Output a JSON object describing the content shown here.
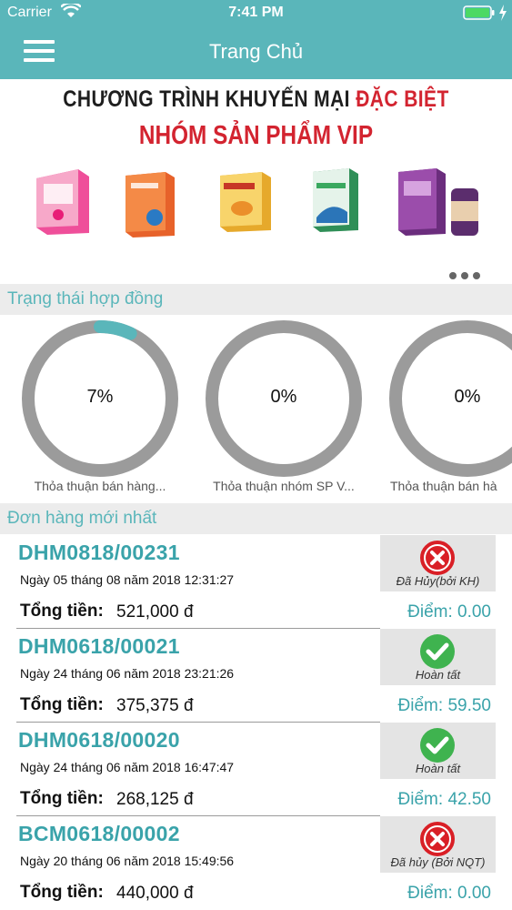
{
  "status_bar": {
    "carrier": "Carrier",
    "time": "7:41 PM"
  },
  "nav": {
    "title": "Trang Chủ"
  },
  "banner": {
    "line1_part1": "CHƯƠNG TRÌNH KHUYẾN MẠI",
    "line1_part2": "ĐẶC BIỆT",
    "line2": "NHÓM SẢN PHẨM VIP",
    "colors": {
      "accent_red": "#d32430"
    }
  },
  "contracts": {
    "header": "Trạng thái hợp đồng",
    "items": [
      {
        "value_label": "7%",
        "percent": 7,
        "name": "Thỏa thuận bán hàng..."
      },
      {
        "value_label": "0%",
        "percent": 0,
        "name": "Thỏa thuận nhóm SP V..."
      },
      {
        "value_label": "0%",
        "percent": 0,
        "name": "Thỏa thuận bán hà"
      }
    ]
  },
  "orders": {
    "header": "Đơn hàng mới nhất",
    "total_label": "Tổng tiền:",
    "items": [
      {
        "code": "DHM0818/00231",
        "date": "Ngày 05 tháng 08 năm 2018 12:31:27",
        "status": "Đã Hủy(bởi KH)",
        "status_icon": "cancel-icon",
        "total": "521,000 đ",
        "points": "Điểm: 0.00"
      },
      {
        "code": "DHM0618/00021",
        "date": "Ngày 24 tháng 06 năm 2018 23:21:26",
        "status": "Hoàn tất",
        "status_icon": "check-icon",
        "total": "375,375 đ",
        "points": "Điểm: 59.50"
      },
      {
        "code": "DHM0618/00020",
        "date": "Ngày 24 tháng 06 năm 2018 16:47:47",
        "status": "Hoàn tất",
        "status_icon": "check-icon",
        "total": "268,125 đ",
        "points": "Điểm: 42.50"
      },
      {
        "code": "BCM0618/00002",
        "date": "Ngày 20 tháng 06 năm 2018 15:49:56",
        "status": "Đã hủy (Bởi NQT)",
        "status_icon": "cancel-icon",
        "total": "440,000 đ",
        "points": "Điểm: 0.00"
      }
    ]
  },
  "colors": {
    "primary": "#5ab6ba",
    "text_accent": "#3aa3aa",
    "gauge_track": "#9b9b9b",
    "success": "#3fb34f",
    "danger": "#d91f26"
  }
}
